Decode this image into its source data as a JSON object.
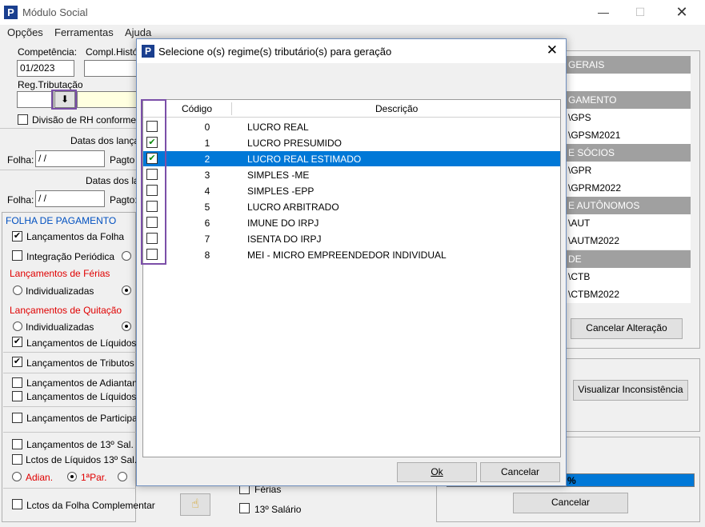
{
  "app": {
    "title": "Módulo Social",
    "logo": "P"
  },
  "menu": [
    "Opções",
    "Ferramentas",
    "Ajuda"
  ],
  "header": {
    "competencia_label": "Competência:",
    "competencia_value": "01/2023",
    "compl_label": "Compl.Histó",
    "regtrib_label": "Reg.Tributação",
    "divisao_label": "Divisão de RH conforme"
  },
  "datas": {
    "lanc_label": "Datas dos lança",
    "folha_label": "Folha:",
    "folha_value": " / /",
    "pagto_label": "Pagto",
    "datas2_label": "Datas dos la",
    "folha2_value": " / /",
    "pagto2_label": "Pagto:"
  },
  "folha": {
    "section": "FOLHA DE PAGAMENTO",
    "lanc_folha": "Lançamentos da Folha",
    "integracao": "Integração Periódica",
    "ferias_title": "Lançamentos de Férias",
    "individualizadas": "Individualizadas",
    "quitacao_title": "Lançamentos de Quitação",
    "individualizadas2": "Individualizadas",
    "liquidos": "Lançamentos de Líquidos",
    "tributos": "Lançamentos de Tributos",
    "adiantam": "Lançamentos de Adiantan",
    "liquidos2": "Lançamentos de Líquidos",
    "particip": "Lançamentos de Participa",
    "sal13": "Lançamentos de 13º Sal.",
    "lctos13": "Lctos de Líquidos 13º Sal.",
    "adian": "Adian.",
    "par1": "1ªPar.",
    "complementar": "Lctos da Folha Complementar",
    "ferias": "Férias",
    "sal13b": "13º Salário"
  },
  "right": {
    "gerais": "GERAIS",
    "gamento": "GAMENTO",
    "gps": "\\GPS",
    "gpsm": "\\GPSM2021",
    "socios": "E SÓCIOS",
    "gpr": "\\GPR",
    "gprm": "\\GPRM2022",
    "autonomos": "E AUTÔNOMOS",
    "aut": "\\AUT",
    "autm": "\\AUTM2022",
    "de": "DE",
    "ctb": "\\CTB",
    "ctbm": "\\CTBM2022",
    "cancelar_alteracao": "Cancelar Alteração",
    "visualizar": "Visualizar Inconsistência",
    "progress_text": "%",
    "progress_value": 1.0,
    "cancelar": "Cancelar"
  },
  "dialog": {
    "title": "Selecione o(s) regime(s) tributário(s) para geração",
    "col_codigo": "Código",
    "col_descricao": "Descrição",
    "rows": [
      {
        "code": "0",
        "desc": "LUCRO REAL",
        "checked": false,
        "selected": false
      },
      {
        "code": "1",
        "desc": "LUCRO PRESUMIDO",
        "checked": true,
        "selected": false
      },
      {
        "code": "2",
        "desc": "LUCRO REAL ESTIMADO",
        "checked": true,
        "selected": true
      },
      {
        "code": "3",
        "desc": "SIMPLES -ME",
        "checked": false,
        "selected": false
      },
      {
        "code": "4",
        "desc": "SIMPLES -EPP",
        "checked": false,
        "selected": false
      },
      {
        "code": "5",
        "desc": "LUCRO ARBITRADO",
        "checked": false,
        "selected": false
      },
      {
        "code": "6",
        "desc": "IMUNE DO IRPJ",
        "checked": false,
        "selected": false
      },
      {
        "code": "7",
        "desc": "ISENTA DO IRPJ",
        "checked": false,
        "selected": false
      },
      {
        "code": "8",
        "desc": "MEI - MICRO EMPREENDEDOR INDIVIDUAL",
        "checked": false,
        "selected": false
      }
    ],
    "ok": "Ok",
    "cancelar": "Cancelar"
  },
  "colors": {
    "selection": "#0078d7",
    "highlight_frame": "#7b4fa8",
    "section_red": "#e00000",
    "section_blue": "#0050c0",
    "logo": "#1a3f8f"
  }
}
